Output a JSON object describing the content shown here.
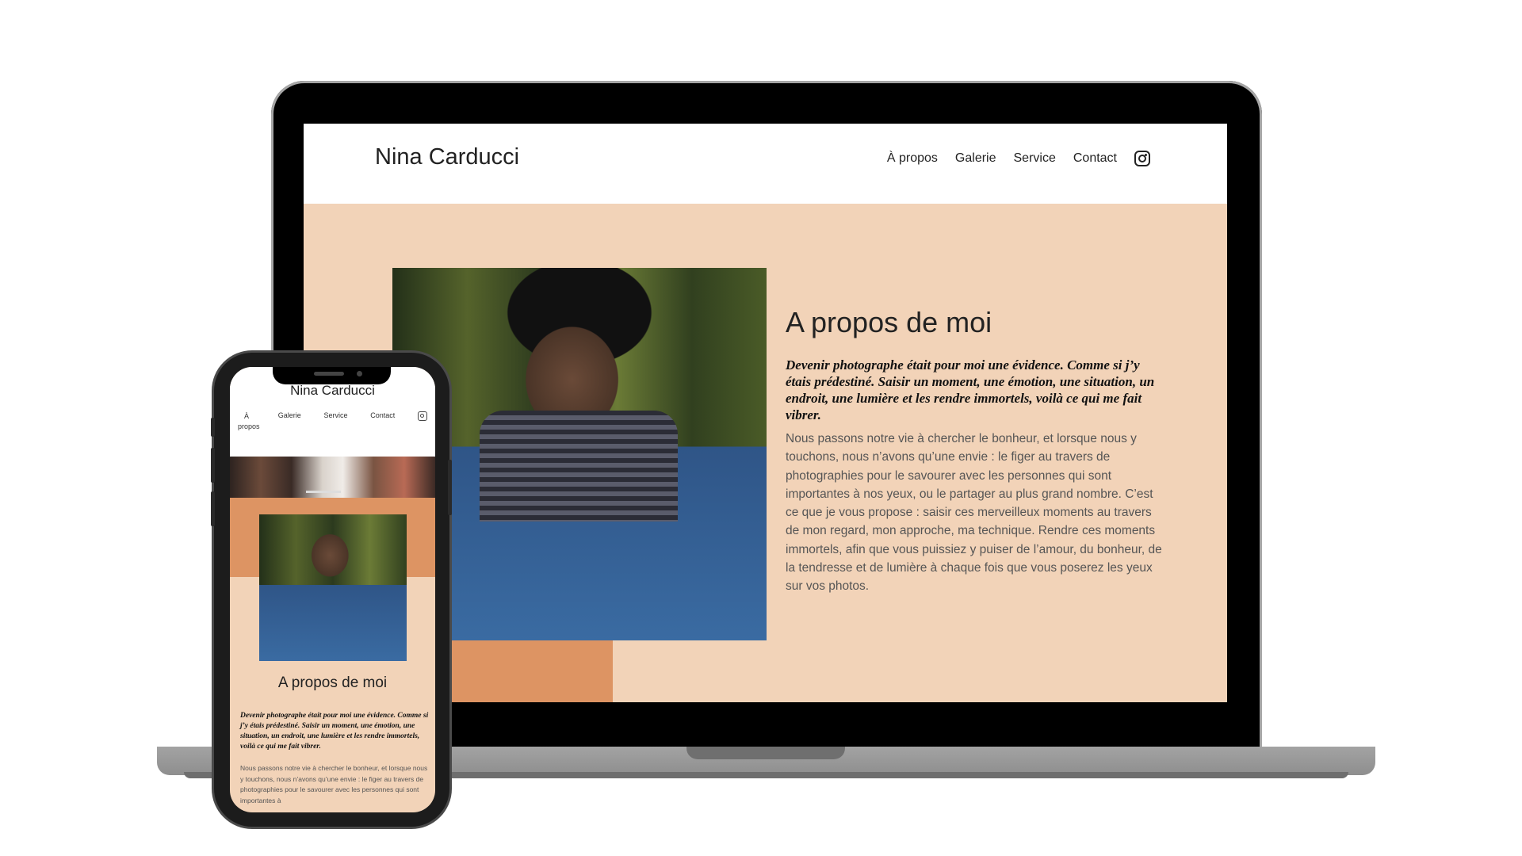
{
  "site": {
    "brand": "Nina Carducci",
    "nav": [
      "À propos",
      "Galerie",
      "Service",
      "Contact"
    ],
    "section_title": "A propos de moi",
    "lead": "Devenir photographe était pour moi une évidence. Comme si j’y étais prédestiné. Saisir un moment, une émotion, une situation, un endroit, une lumière et les rendre immortels, voilà ce qui me fait vibrer.",
    "body": "Nous passons notre vie à chercher le bonheur, et lorsque nous y touchons, nous n’avons qu’une envie : le figer au travers de photographies pour le savourer avec les personnes qui sont importantes à nos yeux, ou le partager au plus grand nombre. C’est ce que je vous propose : saisir ces merveilleux moments au travers de mon regard, mon approche, ma technique. Rendre ces moments immortels, afin que vous puissiez y puiser de l’amour, du bonheur, de la tendresse et de lumière à chaque fois que vous poserez les yeux sur vos photos."
  },
  "phone": {
    "body_excerpt": "Nous passons notre vie à chercher le bonheur, et lorsque nous y touchons, nous n’avons qu’une envie : le figer au travers de photographies pour le savourer avec les personnes qui sont importantes à"
  },
  "icons": {
    "social": "instagram-icon"
  },
  "colors": {
    "background": "#f2d3b8",
    "accent": "#dd9463",
    "header": "#ffffff",
    "device_frame": "#000000",
    "laptop_base": "#9b9b9b"
  }
}
